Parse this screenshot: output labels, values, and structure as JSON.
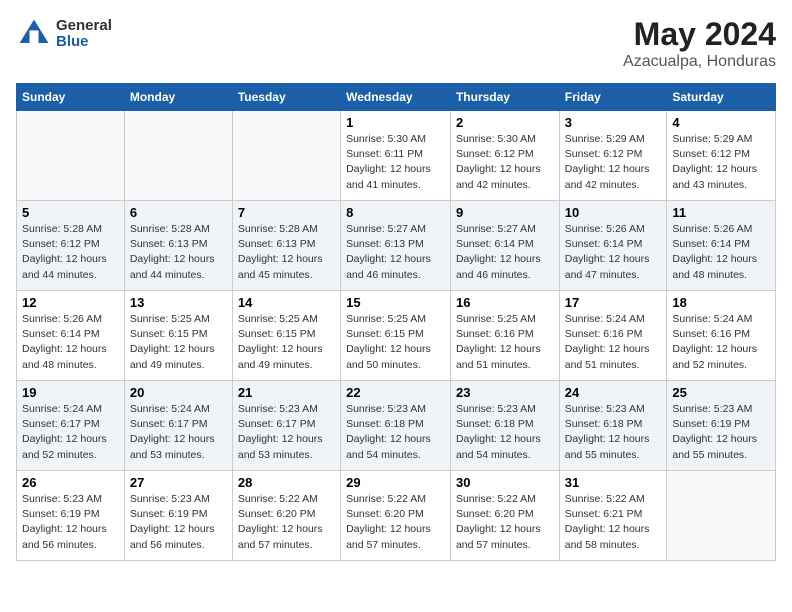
{
  "header": {
    "logo_general": "General",
    "logo_blue": "Blue",
    "title": "May 2024",
    "location": "Azacualpa, Honduras"
  },
  "weekdays": [
    "Sunday",
    "Monday",
    "Tuesday",
    "Wednesday",
    "Thursday",
    "Friday",
    "Saturday"
  ],
  "weeks": [
    [
      {
        "day": "",
        "info": ""
      },
      {
        "day": "",
        "info": ""
      },
      {
        "day": "",
        "info": ""
      },
      {
        "day": "1",
        "info": "Sunrise: 5:30 AM\nSunset: 6:11 PM\nDaylight: 12 hours\nand 41 minutes."
      },
      {
        "day": "2",
        "info": "Sunrise: 5:30 AM\nSunset: 6:12 PM\nDaylight: 12 hours\nand 42 minutes."
      },
      {
        "day": "3",
        "info": "Sunrise: 5:29 AM\nSunset: 6:12 PM\nDaylight: 12 hours\nand 42 minutes."
      },
      {
        "day": "4",
        "info": "Sunrise: 5:29 AM\nSunset: 6:12 PM\nDaylight: 12 hours\nand 43 minutes."
      }
    ],
    [
      {
        "day": "5",
        "info": "Sunrise: 5:28 AM\nSunset: 6:12 PM\nDaylight: 12 hours\nand 44 minutes."
      },
      {
        "day": "6",
        "info": "Sunrise: 5:28 AM\nSunset: 6:13 PM\nDaylight: 12 hours\nand 44 minutes."
      },
      {
        "day": "7",
        "info": "Sunrise: 5:28 AM\nSunset: 6:13 PM\nDaylight: 12 hours\nand 45 minutes."
      },
      {
        "day": "8",
        "info": "Sunrise: 5:27 AM\nSunset: 6:13 PM\nDaylight: 12 hours\nand 46 minutes."
      },
      {
        "day": "9",
        "info": "Sunrise: 5:27 AM\nSunset: 6:14 PM\nDaylight: 12 hours\nand 46 minutes."
      },
      {
        "day": "10",
        "info": "Sunrise: 5:26 AM\nSunset: 6:14 PM\nDaylight: 12 hours\nand 47 minutes."
      },
      {
        "day": "11",
        "info": "Sunrise: 5:26 AM\nSunset: 6:14 PM\nDaylight: 12 hours\nand 48 minutes."
      }
    ],
    [
      {
        "day": "12",
        "info": "Sunrise: 5:26 AM\nSunset: 6:14 PM\nDaylight: 12 hours\nand 48 minutes."
      },
      {
        "day": "13",
        "info": "Sunrise: 5:25 AM\nSunset: 6:15 PM\nDaylight: 12 hours\nand 49 minutes."
      },
      {
        "day": "14",
        "info": "Sunrise: 5:25 AM\nSunset: 6:15 PM\nDaylight: 12 hours\nand 49 minutes."
      },
      {
        "day": "15",
        "info": "Sunrise: 5:25 AM\nSunset: 6:15 PM\nDaylight: 12 hours\nand 50 minutes."
      },
      {
        "day": "16",
        "info": "Sunrise: 5:25 AM\nSunset: 6:16 PM\nDaylight: 12 hours\nand 51 minutes."
      },
      {
        "day": "17",
        "info": "Sunrise: 5:24 AM\nSunset: 6:16 PM\nDaylight: 12 hours\nand 51 minutes."
      },
      {
        "day": "18",
        "info": "Sunrise: 5:24 AM\nSunset: 6:16 PM\nDaylight: 12 hours\nand 52 minutes."
      }
    ],
    [
      {
        "day": "19",
        "info": "Sunrise: 5:24 AM\nSunset: 6:17 PM\nDaylight: 12 hours\nand 52 minutes."
      },
      {
        "day": "20",
        "info": "Sunrise: 5:24 AM\nSunset: 6:17 PM\nDaylight: 12 hours\nand 53 minutes."
      },
      {
        "day": "21",
        "info": "Sunrise: 5:23 AM\nSunset: 6:17 PM\nDaylight: 12 hours\nand 53 minutes."
      },
      {
        "day": "22",
        "info": "Sunrise: 5:23 AM\nSunset: 6:18 PM\nDaylight: 12 hours\nand 54 minutes."
      },
      {
        "day": "23",
        "info": "Sunrise: 5:23 AM\nSunset: 6:18 PM\nDaylight: 12 hours\nand 54 minutes."
      },
      {
        "day": "24",
        "info": "Sunrise: 5:23 AM\nSunset: 6:18 PM\nDaylight: 12 hours\nand 55 minutes."
      },
      {
        "day": "25",
        "info": "Sunrise: 5:23 AM\nSunset: 6:19 PM\nDaylight: 12 hours\nand 55 minutes."
      }
    ],
    [
      {
        "day": "26",
        "info": "Sunrise: 5:23 AM\nSunset: 6:19 PM\nDaylight: 12 hours\nand 56 minutes."
      },
      {
        "day": "27",
        "info": "Sunrise: 5:23 AM\nSunset: 6:19 PM\nDaylight: 12 hours\nand 56 minutes."
      },
      {
        "day": "28",
        "info": "Sunrise: 5:22 AM\nSunset: 6:20 PM\nDaylight: 12 hours\nand 57 minutes."
      },
      {
        "day": "29",
        "info": "Sunrise: 5:22 AM\nSunset: 6:20 PM\nDaylight: 12 hours\nand 57 minutes."
      },
      {
        "day": "30",
        "info": "Sunrise: 5:22 AM\nSunset: 6:20 PM\nDaylight: 12 hours\nand 57 minutes."
      },
      {
        "day": "31",
        "info": "Sunrise: 5:22 AM\nSunset: 6:21 PM\nDaylight: 12 hours\nand 58 minutes."
      },
      {
        "day": "",
        "info": ""
      }
    ]
  ]
}
